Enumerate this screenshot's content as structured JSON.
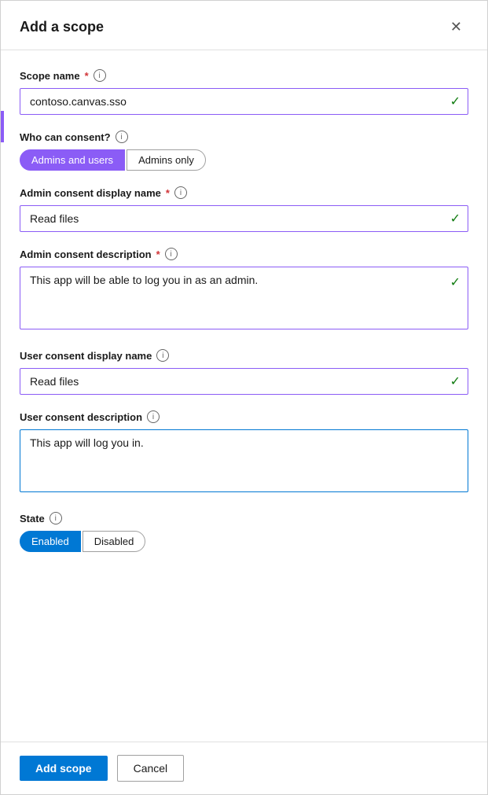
{
  "dialog": {
    "title": "Add a scope",
    "close_label": "×"
  },
  "scope_name": {
    "label": "Scope name",
    "required": true,
    "value": "contoso.canvas.sso",
    "info_title": "Scope name info"
  },
  "who_can_consent": {
    "label": "Who can consent?",
    "info_title": "Who can consent info",
    "options": [
      {
        "label": "Admins and users",
        "active": true
      },
      {
        "label": "Admins only",
        "active": false
      }
    ]
  },
  "admin_consent_display_name": {
    "label": "Admin consent display name",
    "required": true,
    "value": "Read files",
    "info_title": "Admin consent display name info"
  },
  "admin_consent_description": {
    "label": "Admin consent description",
    "required": true,
    "value": "This app will be able to log you in as an admin.",
    "info_title": "Admin consent description info"
  },
  "user_consent_display_name": {
    "label": "User consent display name",
    "required": false,
    "value": "Read files",
    "info_title": "User consent display name info"
  },
  "user_consent_description": {
    "label": "User consent description",
    "required": false,
    "value": "This app will log you in.",
    "info_title": "User consent description info"
  },
  "state": {
    "label": "State",
    "info_title": "State info",
    "options": [
      {
        "label": "Enabled",
        "active": true
      },
      {
        "label": "Disabled",
        "active": false
      }
    ]
  },
  "footer": {
    "add_scope_label": "Add scope",
    "cancel_label": "Cancel"
  },
  "icons": {
    "check": "✓",
    "info": "i",
    "close": "✕"
  }
}
